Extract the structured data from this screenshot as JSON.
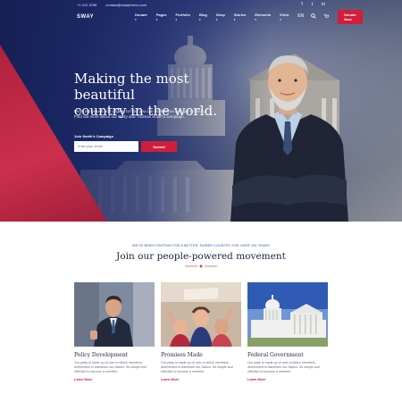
{
  "topbar": {
    "phone": "+1 212 3798",
    "email": "contact@swayfreeco.com",
    "social": [
      "f",
      "t",
      "in"
    ]
  },
  "nav": {
    "logo": "SWAY",
    "menu": [
      "Donate",
      "Pages",
      "Portfolio",
      "Blog",
      "Shop",
      "Stories",
      "Elements",
      "Extra"
    ],
    "lang": "EN",
    "donate_label": "Donate Now"
  },
  "hero": {
    "title_line1": "Making the most beautiful",
    "title_line2": "country in the world.",
    "subtitle_line1": "From our values and origins, to how you can work for us and get in touch,",
    "subtitle_line2": "Find out more about our Party and Thomas Smith's campaign.",
    "form_label": "Join Smith's Campaign",
    "email_placeholder": "Enter your email",
    "submit_label": "Submit"
  },
  "section": {
    "eyebrow": "WE'VE BEEN FIGHTING FOR A BETTER, FAIRER COUNTRY FOR OVER 100 YEARS",
    "title": "Join our people-powered movement"
  },
  "cards": [
    {
      "title": "Policy Development",
      "text": "Our party is made up of over a million members, determined to transform our Nation. It's simple and effective to become a member.",
      "link": "Learn More"
    },
    {
      "title": "Promises Made",
      "text": "Our party is made up of over a million members, determined to transform our Nation. It's simple and effective to become a member.",
      "link": "Learn More"
    },
    {
      "title": "Federal Government",
      "text": "Our party is made up of over a million members, determined to transform our Nation. It's simple and effective to become a member.",
      "link": "Learn More"
    }
  ],
  "colors": {
    "accent_red": "#d11e3a",
    "navy": "#1e2f6e"
  }
}
